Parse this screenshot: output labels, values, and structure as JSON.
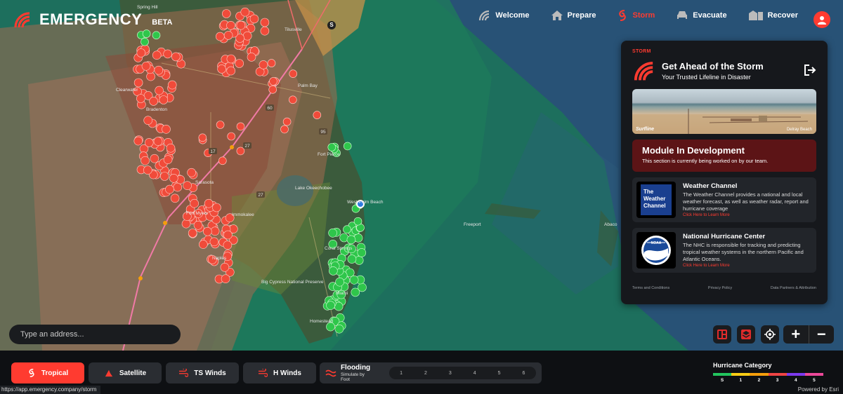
{
  "app": {
    "name": "EMERGENCY",
    "beta": "BETA"
  },
  "nav": [
    {
      "label": "Welcome",
      "icon": "signal-icon"
    },
    {
      "label": "Prepare",
      "icon": "house-icon"
    },
    {
      "label": "Storm",
      "icon": "hurricane-icon",
      "active": true
    },
    {
      "label": "Evacuate",
      "icon": "car-icon"
    },
    {
      "label": "Recover",
      "icon": "buildings-icon"
    }
  ],
  "panel": {
    "tag": "STORM",
    "title": "Get Ahead of the Storm",
    "subtitle": "Your Trusted Lifeline in Disaster",
    "webcam_brand": "Surfline",
    "webcam_location": "Delray Beach",
    "dev_title": "Module In Development",
    "dev_text": "This section is currently being worked on by our team.",
    "cards": [
      {
        "title": "Weather Channel",
        "text": "The Weather Channel provides a national and local weather forecast, as well as weather radar, report and hurricane coverage",
        "link": "Click Here to Learn More",
        "logo_text": "The Weather Channel"
      },
      {
        "title": "National Hurricane Center",
        "text": "The NHC is responsible for tracking and predicting tropical weather systems in the northern Pacific and Atlantic Oceans.",
        "link": "Click Here to Learn More",
        "logo_text": "NOAA"
      }
    ],
    "footer": [
      "Terms and Conditions",
      "Privacy Policy",
      "Data Partners & Attribution"
    ]
  },
  "search": {
    "placeholder": "Type an address..."
  },
  "layers": [
    {
      "label": "Tropical",
      "active": true
    },
    {
      "label": "Satellite"
    },
    {
      "label": "TS Winds"
    },
    {
      "label": "H Winds"
    }
  ],
  "flooding": {
    "title": "Flooding",
    "subtitle": "Simulate by Foot",
    "levels": [
      "1",
      "2",
      "3",
      "4",
      "5",
      "6"
    ]
  },
  "legend": {
    "title": "Hurricane Category",
    "categories": [
      "S",
      "1",
      "2",
      "3",
      "4",
      "5"
    ],
    "colors": [
      "#22c55e",
      "#facc15",
      "#f59e0b",
      "#ef4444",
      "#7c3aed",
      "#ec4899"
    ]
  },
  "map": {
    "places": [
      "Tilusville",
      "Palm Bay",
      "Fort Pierce",
      "Lake Okeechobee",
      "West Palm Beach",
      "Immokalee",
      "Big Cypress National Preserve",
      "Coral Springs",
      "Miami",
      "Homestead",
      "Freeport",
      "Abaco",
      "Clearwater",
      "Bradenton",
      "Sarasota",
      "Fort Myers",
      "Naples",
      "Spring Hill"
    ],
    "roads": [
      "60",
      "17",
      "27",
      "27",
      "95"
    ],
    "s_marker": "S"
  },
  "status_url": "https://app.emergency.company/storm",
  "powered_by": "Powered by Esri"
}
